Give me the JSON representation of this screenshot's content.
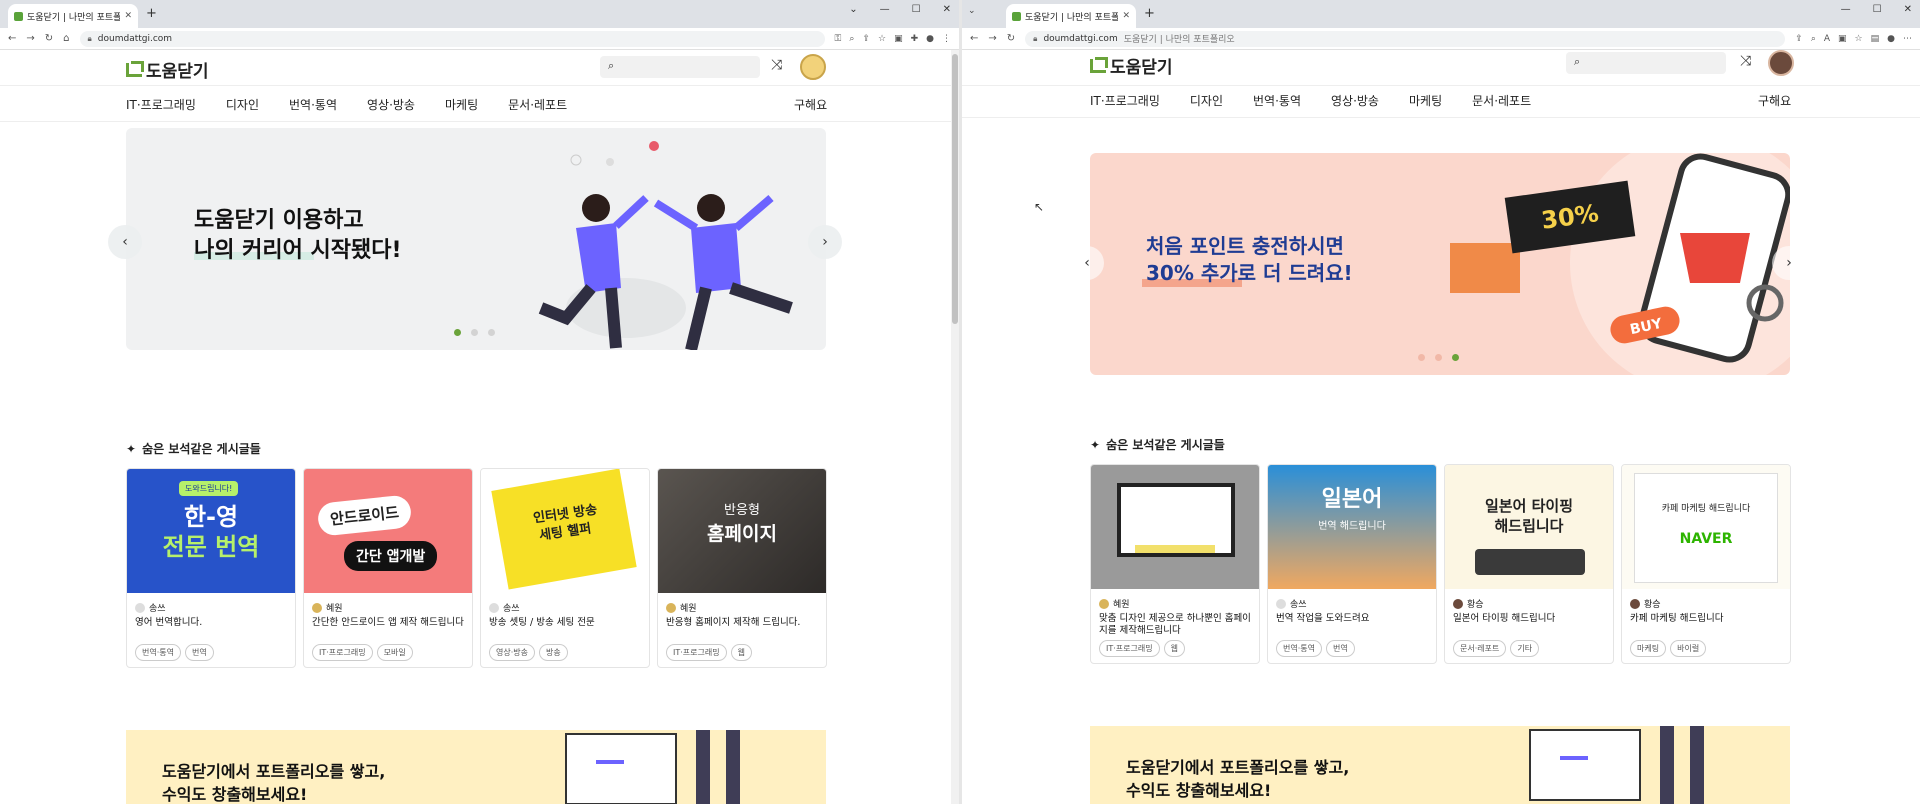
{
  "left": {
    "tab_title": "도움닫기 | 나만의 포트폴리오",
    "url": "doumdattgi.com",
    "url_suffix": "",
    "logo_text": "도움닫기",
    "nav_items": [
      "IT·프로그래밍",
      "디자인",
      "번역·통역",
      "영상·방송",
      "마케팅",
      "문서·레포트"
    ],
    "nav_buy": "구해요",
    "banner_line1": "도움닫기 이용하고",
    "banner_line2": "나의 커리어 시작됐다!",
    "section_title": "숨은 보석같은 게시글들",
    "cards": [
      {
        "author": "송쓰",
        "title": "영어 번역합니다.",
        "tags": [
          "번역·통역",
          "번역"
        ],
        "thumb_text1": "한-영",
        "thumb_text2": "전문 번역",
        "thumb_small": "도와드립니다!"
      },
      {
        "author": "혜원",
        "title": "간단한 안드로이드 앱 제작 해드립니다",
        "tags": [
          "IT·프로그래밍",
          "모바일"
        ],
        "thumb_text1": "안드로이드",
        "thumb_text2": "간단 앱개발"
      },
      {
        "author": "송쓰",
        "title": "방송 셋팅 / 방송 세팅 전문",
        "tags": [
          "영상·방송",
          "방송"
        ],
        "thumb_text1": "인터넷 방송",
        "thumb_text2": "세팅 헬퍼"
      },
      {
        "author": "혜원",
        "title": "반응형 홈페이지 제작해 드립니다.",
        "tags": [
          "IT·프로그래밍",
          "웹"
        ],
        "thumb_text1": "반응형",
        "thumb_text2": "홈페이지"
      }
    ],
    "promo_line1": "도움닫기에서 포트폴리오를 쌓고,",
    "promo_line2": "수익도 창출해보세요!"
  },
  "right": {
    "tab_title": "도움닫기 | 나만의 포트폴리오",
    "url": "doumdattgi.com",
    "url_suffix": "도움닫기 | 나만의 포트폴리오",
    "logo_text": "도움닫기",
    "nav_items": [
      "IT·프로그래밍",
      "디자인",
      "번역·통역",
      "영상·방송",
      "마케팅",
      "문서·레포트"
    ],
    "nav_buy": "구해요",
    "banner_line1": "처음 포인트 충전하시면",
    "banner_line2": "30% 추가로 더 드려요!",
    "banner_badge": "30%",
    "banner_buy": "BUY",
    "section_title": "숨은 보석같은 게시글들",
    "cards": [
      {
        "author": "혜원",
        "title": "맞춤 디자인 제공으로 하나뿐인 홈페이지를 제작해드립니다",
        "tags": [
          "IT·프로그래밍",
          "웹"
        ]
      },
      {
        "author": "송쓰",
        "title": "번역 작업을 도와드려요",
        "tags": [
          "번역·통역",
          "번역"
        ],
        "thumb_text1": "일본어",
        "thumb_text2": "번역 해드립니다"
      },
      {
        "author": "황승",
        "title": "일본어 타이핑 해드립니다",
        "tags": [
          "문서·레포트",
          "기타"
        ],
        "thumb_text1": "일본어 타이핑",
        "thumb_text2": "해드립니다"
      },
      {
        "author": "황승",
        "title": "카페 마케팅 해드립니다",
        "tags": [
          "마케팅",
          "바이럴"
        ],
        "thumb_text1": "카페 마케팅 해드립니다",
        "thumb_text2": "NAVER"
      }
    ],
    "promo_line1": "도움닫기에서 포트폴리오를 쌓고,",
    "promo_line2": "수익도 창출해보세요!"
  }
}
